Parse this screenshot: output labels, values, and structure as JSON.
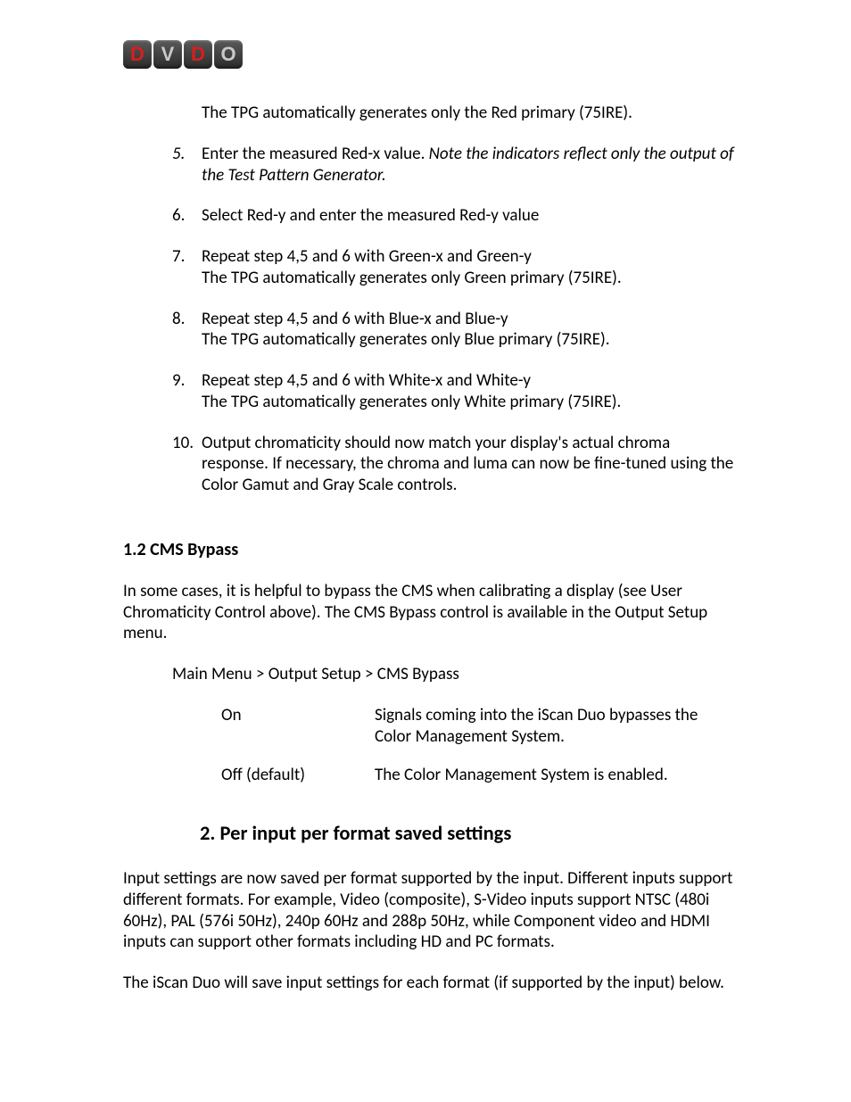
{
  "logo": {
    "letters": [
      "D",
      "V",
      "D",
      "O"
    ]
  },
  "intro_line": "The TPG automatically generates only the Red primary (75IRE).",
  "items": [
    {
      "num": "5.",
      "italicNum": true,
      "paras": [
        {
          "main": "Enter the measured Red-x value. ",
          "italic": "Note the indicators reflect only the output of the Test Pattern Generator."
        }
      ]
    },
    {
      "num": "6.",
      "paras": [
        {
          "main": "Select Red-y and enter the measured Red-y value"
        }
      ]
    },
    {
      "num": "7.",
      "paras": [
        {
          "main": "Repeat step 4,5 and 6 with Green-x and Green-y"
        },
        {
          "main": "The TPG automatically generates only Green primary (75IRE)."
        }
      ]
    },
    {
      "num": "8.",
      "paras": [
        {
          "main": "Repeat step 4,5 and 6 with Blue-x and Blue-y"
        },
        {
          "main": "The TPG automatically generates only Blue primary (75IRE)."
        }
      ]
    },
    {
      "num": "9.",
      "paras": [
        {
          "main": "Repeat step 4,5 and 6 with White-x and White-y"
        },
        {
          "main": "The TPG automatically generates only White primary (75IRE)."
        }
      ]
    },
    {
      "num": "10.",
      "paras": [
        {
          "main": "Output chromaticity should now match your display's actual chroma response. If necessary, the chroma and luma can now be fine-tuned using the Color Gamut and Gray Scale controls."
        }
      ]
    }
  ],
  "section12_heading": "1.2 CMS Bypass",
  "section12_para": "In some cases, it is helpful to bypass the CMS when calibrating a display (see User Chromaticity Control above).  The CMS Bypass control is available in the Output Setup menu.",
  "section12_path": "Main Menu > Output Setup > CMS Bypass",
  "options": [
    {
      "label": "On",
      "desc": "Signals coming into the iScan Duo bypasses the Color Management System."
    },
    {
      "label": "Off (default)",
      "desc": "The Color Management System is enabled."
    }
  ],
  "section2_heading": "2.  Per input per format saved settings",
  "section2_para1": "Input settings are now saved per format supported by the input.  Different inputs support different formats.  For example, Video (composite), S-Video inputs support NTSC (480i 60Hz), PAL (576i 50Hz), 240p 60Hz and 288p 50Hz, while Component video and HDMI inputs can support other formats including HD and PC formats.",
  "section2_para2": "The iScan Duo will save input settings for each format (if supported by the input) below."
}
